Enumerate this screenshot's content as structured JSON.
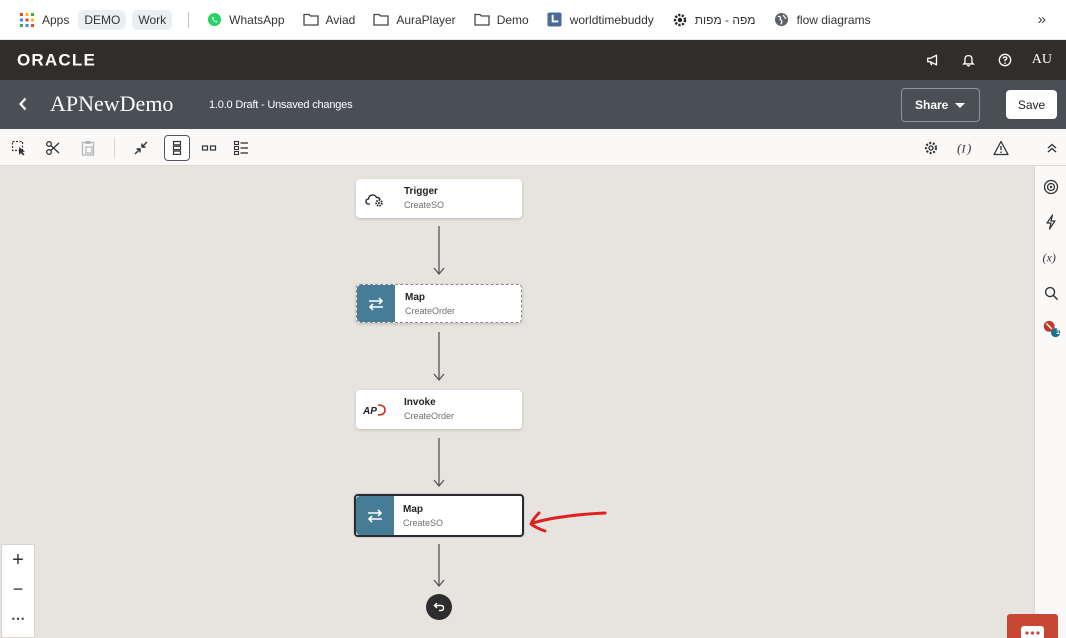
{
  "bookmarks": {
    "items": [
      {
        "label": "Apps",
        "icon": "apps-grid-icon"
      },
      {
        "label": "DEMO",
        "icon": ""
      },
      {
        "label": "Work",
        "icon": ""
      },
      {
        "label": "WhatsApp",
        "icon": "whatsapp-icon"
      },
      {
        "label": "Aviad",
        "icon": "folder-icon"
      },
      {
        "label": "AuraPlayer",
        "icon": "folder-icon"
      },
      {
        "label": "Demo",
        "icon": "folder-icon"
      },
      {
        "label": "worldtimebuddy",
        "icon": "clock-icon"
      },
      {
        "label": "מפה - מפות",
        "icon": "gear-icon"
      },
      {
        "label": "flow diagrams",
        "icon": "globe-icon"
      }
    ],
    "more": "»"
  },
  "header": {
    "logo": "ORACLE",
    "avatar": "AU"
  },
  "titlebar": {
    "title": "APNewDemo",
    "status": "1.0.0 Draft - Unsaved changes",
    "share_label": "Share",
    "save_label": "Save"
  },
  "nodes": [
    {
      "title": "Trigger",
      "subtitle": "CreateSO",
      "icon": "cloud-gear-icon"
    },
    {
      "title": "Map",
      "subtitle": "CreateOrder",
      "icon": "map-arrows-icon"
    },
    {
      "title": "Invoke",
      "subtitle": "CreateOrder",
      "icon": "ap-logo-icon"
    },
    {
      "title": "Map",
      "subtitle": "CreateSO",
      "icon": "map-arrows-icon"
    }
  ],
  "right_rail": {
    "badge_count": "1"
  },
  "zoom": {
    "zoom_in": "+",
    "zoom_out": "−",
    "more": "⋯"
  },
  "colors": {
    "oracle_header": "#312d2a",
    "titlebar": "#4a4f55",
    "map_icon_bg": "#467c96",
    "annotation_red": "#e0201e",
    "chat_button": "#c74634"
  }
}
